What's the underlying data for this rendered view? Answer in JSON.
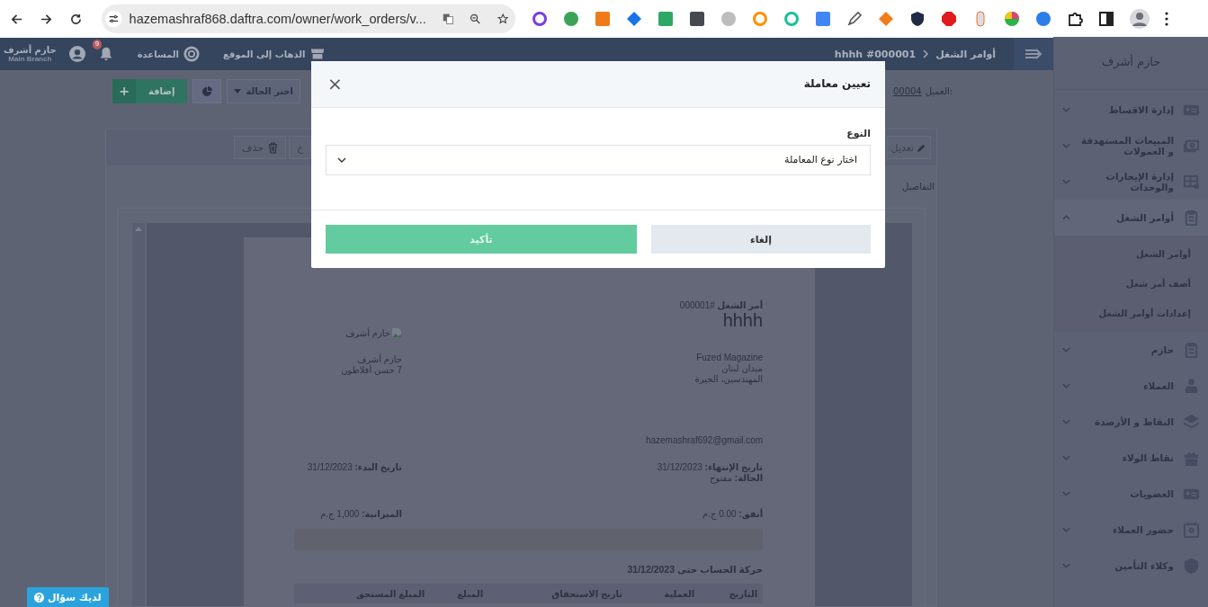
{
  "browser": {
    "url": "hazemashraf868.daftra.com/owner/work_orders/v..."
  },
  "topbar": {
    "breadcrumb": [
      {
        "label": "أوامر الشغل"
      },
      {
        "label": "hhhh #000001"
      }
    ],
    "links": [
      {
        "label": "الذهاب إلى الموقع",
        "kind": "store"
      },
      {
        "label": "المساعدة",
        "kind": "help"
      }
    ],
    "notifications": {
      "count": "9"
    },
    "user": {
      "name": "حازم أشرف",
      "branch": "Main Branch"
    }
  },
  "toolbar": {
    "add_icon": "+",
    "add": "إضافة",
    "status": "اختر الحالة",
    "client_label": "العميل:",
    "client_id": "00004"
  },
  "card": {
    "edit": "تعديل",
    "actions": [
      {
        "label": "خ",
        "kind": "plain"
      },
      {
        "label": "حذف",
        "kind": "delete"
      }
    ],
    "tab": "التفاصيل"
  },
  "document": {
    "title": "**أمر الشغل** #000001",
    "name": "hhhh",
    "client_lines": [
      "Fuzed Magazine",
      "ميدان لبنان",
      "المهندسين، الجيزة"
    ],
    "logo_alt": "حازم أشرف",
    "company_lines": [
      "حازم أشرف",
      "7 حسن أفلاطون"
    ],
    "email": "hazemashraf692@gmail.com",
    "fields": [
      "**تاريخ الإنتهاء:** 31/12/2023",
      "**الحالة:** مفتوح"
    ],
    "start": "**تاريخ البدء:** 31/12/2023",
    "spent": "**أنفق:** 0.00 ج.م",
    "budget": "**الميزانية:** 1,000 ج.م",
    "statement_title": "حركة الحساب حتى 31/12/2023",
    "table_columns": [
      "التاريخ",
      "العملية",
      "تاريخ الاستحقاق",
      "المبلغ",
      "المبلغ المستحق"
    ]
  },
  "sidebar": {
    "title": "حازم أشرف",
    "items": [
      {
        "label": "إدارة الاقساط",
        "expanded": false
      },
      {
        "label": "المبيعات المستهدفة و العمولات",
        "expanded": false
      },
      {
        "label": "إدارة الإيجارات والوحدات",
        "expanded": false
      },
      {
        "label": "أوامر الشغل",
        "expanded": true,
        "children": [
          {
            "label": "أوامر الشغل"
          },
          {
            "label": "أضف أمر شغل"
          },
          {
            "label": "إعدادات أوامر الشغل"
          }
        ]
      },
      {
        "label": "حازم",
        "expanded": false
      },
      {
        "label": "العملاء",
        "expanded": false
      },
      {
        "label": "النقاط و الأرصدة",
        "expanded": false
      },
      {
        "label": "نقاط الولاء",
        "expanded": false
      },
      {
        "label": "العضويات",
        "expanded": false
      },
      {
        "label": "حضور العملاء",
        "expanded": false
      },
      {
        "label": "وكلاء التأمين",
        "expanded": false
      }
    ]
  },
  "modal": {
    "title": "تعيين معاملة",
    "close": "×",
    "field_label": "النوع",
    "placeholder": "اختار نوع المعاملة",
    "buttons": [
      {
        "label": "إلغاء",
        "kind": "secondary",
        "disabled": false
      },
      {
        "label": "تأكيد",
        "kind": "primary",
        "disabled": true
      }
    ]
  },
  "help_button": {
    "label": "لديك سؤال"
  }
}
